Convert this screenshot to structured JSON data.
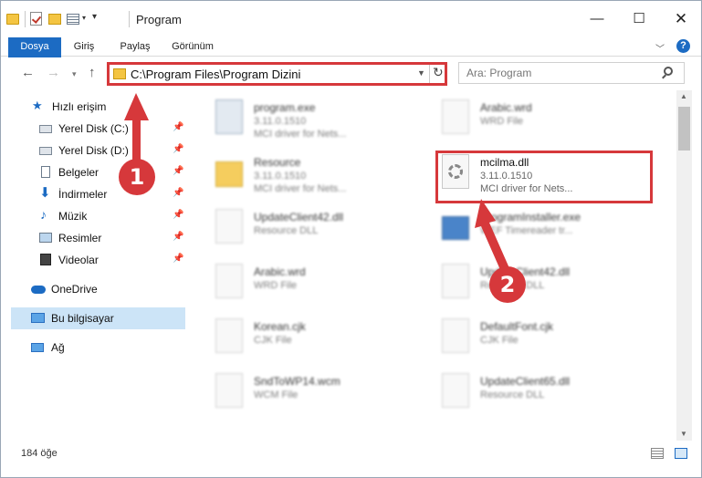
{
  "window": {
    "title": "Program"
  },
  "ribbon": {
    "tabs": [
      "Dosya",
      "Giriş",
      "Paylaş",
      "Görünüm"
    ]
  },
  "address": {
    "path": "C:\\Program Files\\Program Dizini"
  },
  "search": {
    "placeholder": "Ara: Program"
  },
  "sidebar": {
    "items": [
      {
        "label": "Hızlı erişim",
        "icon": "star-icon"
      },
      {
        "label": "Yerel Disk (C:)",
        "icon": "drive-icon",
        "pinned": true
      },
      {
        "label": "Yerel Disk (D:)",
        "icon": "drive-icon",
        "pinned": true
      },
      {
        "label": "Belgeler",
        "icon": "documents-icon",
        "pinned": true
      },
      {
        "label": "İndirmeler",
        "icon": "download-icon",
        "pinned": true
      },
      {
        "label": "Müzik",
        "icon": "music-icon",
        "pinned": true
      },
      {
        "label": "Resimler",
        "icon": "pictures-icon",
        "pinned": true
      },
      {
        "label": "Videolar",
        "icon": "videos-icon",
        "pinned": true
      },
      {
        "label": "OneDrive",
        "icon": "cloud-icon"
      },
      {
        "label": "Bu bilgisayar",
        "icon": "computer-icon",
        "selected": true
      },
      {
        "label": "Ağ",
        "icon": "network-icon"
      }
    ]
  },
  "files": [
    {
      "name": "program.exe",
      "line2": "3.11.0.1510",
      "line3": "MCI driver for Nets...",
      "kind": "exe"
    },
    {
      "name": "Arabic.wrd",
      "line2": "WRD File",
      "line3": "",
      "kind": "doc"
    },
    {
      "name": "Resource",
      "line2": "3.11.0.1510",
      "line3": "MCI driver for Nets...",
      "kind": "folder"
    },
    {
      "name": "mcilma.dll",
      "line2": "3.11.0.1510",
      "line3": "MCI driver for Nets...",
      "kind": "dll"
    },
    {
      "name": "UpdateClient42.dll",
      "line2": "Resource DLL",
      "line3": "",
      "kind": "dll"
    },
    {
      "name": "ProgramInstaller.exe",
      "line2": "WEF Timereader tr...",
      "line3": "",
      "kind": "blue"
    },
    {
      "name": "Arabic.wrd",
      "line2": "WRD File",
      "line3": "",
      "kind": "doc"
    },
    {
      "name": "UpdateClient42.dll",
      "line2": "Resource DLL",
      "line3": "",
      "kind": "dll"
    },
    {
      "name": "Korean.cjk",
      "line2": "CJK File",
      "line3": "",
      "kind": "doc"
    },
    {
      "name": "DefaultFont.cjk",
      "line2": "CJK File",
      "line3": "",
      "kind": "doc"
    },
    {
      "name": "SndToWP14.wcm",
      "line2": "WCM File",
      "line3": "",
      "kind": "doc"
    },
    {
      "name": "UpdateClient65.dll",
      "line2": "Resource DLL",
      "line3": "",
      "kind": "dll"
    }
  ],
  "status": {
    "item_count": "184 öğe"
  },
  "annotations": {
    "step1": "1",
    "step2": "2",
    "color": "#d6383b"
  }
}
